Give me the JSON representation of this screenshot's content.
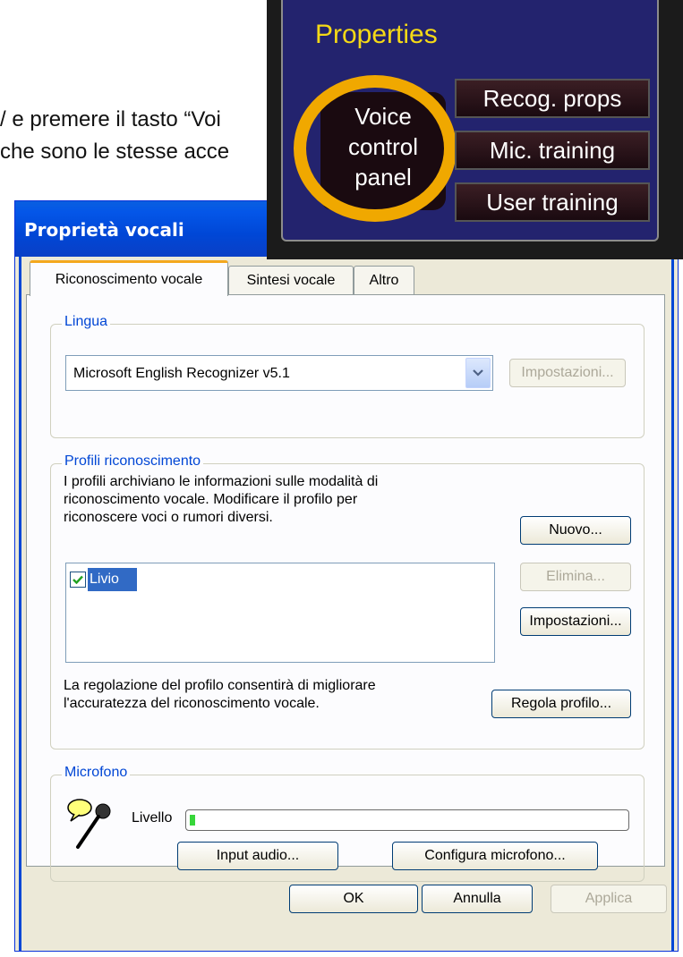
{
  "background_text": {
    "line1": "/ e premere il tasto “Voi",
    "line2": "che sono le stesse acce"
  },
  "overlay": {
    "title": "Properties",
    "voice_control_panel_lines": [
      "Voice",
      "control",
      "panel"
    ],
    "buttons": [
      "Recog. props",
      "Mic. training",
      "User training"
    ],
    "title_color": "#f5d916",
    "highlight_color": "#f0a800"
  },
  "dialog": {
    "title": "Proprietà vocali",
    "tabs": [
      "Riconoscimento vocale",
      "Sintesi vocale",
      "Altro"
    ],
    "lingua": {
      "legend": "Lingua",
      "selected": "Microsoft English Recognizer v5.1",
      "settings_button": "Impostazioni..."
    },
    "profili": {
      "legend": "Profili riconoscimento",
      "description": [
        "I profili archiviano le informazioni sulle modalità di",
        "riconoscimento vocale. Modificare il profilo per",
        "riconoscere voci o rumori diversi."
      ],
      "new_button": "Nuovo...",
      "delete_button": "Elimina...",
      "settings_button": "Impostazioni...",
      "profiles": [
        {
          "name": "Livio",
          "checked": true
        }
      ],
      "adjust_text": [
        "La regolazione del profilo consentirà di migliorare",
        "l'accuratezza del riconoscimento vocale."
      ],
      "adjust_button": "Regola profilo..."
    },
    "microfono": {
      "legend": "Microfono",
      "level_label": "Livello",
      "level_fraction": 0.01,
      "input_button": "Input audio...",
      "configure_button": "Configura microfono..."
    },
    "footer": {
      "ok": "OK",
      "cancel": "Annulla",
      "apply": "Applica"
    }
  }
}
